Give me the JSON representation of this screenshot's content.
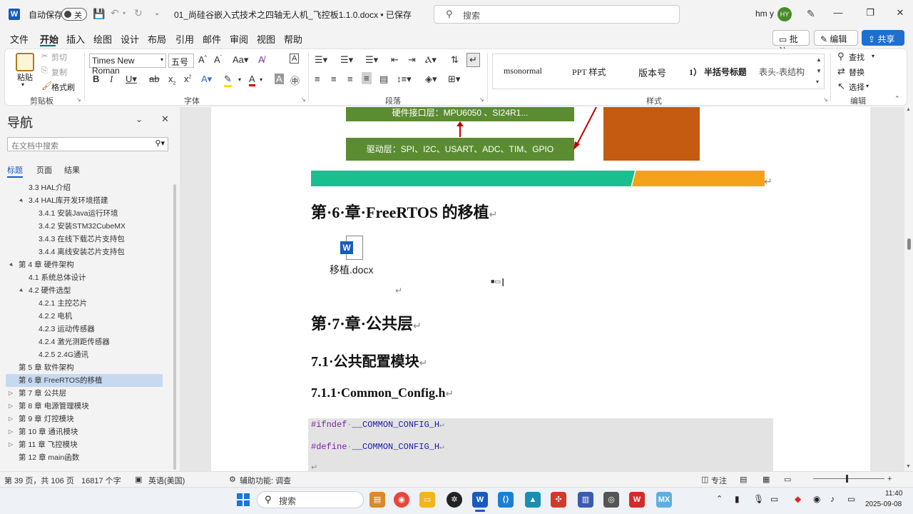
{
  "titlebar": {
    "autosave_label": "自动保存",
    "autosave_state": "关",
    "doc_title": "01_尚硅谷嵌入式技术之四轴无人机_飞控板1.1.0.docx • 已保存",
    "search_placeholder": "搜索",
    "user_name": "hm y",
    "user_initials": "HY"
  },
  "menu": {
    "tabs": [
      "文件",
      "开始",
      "插入",
      "绘图",
      "设计",
      "布局",
      "引用",
      "邮件",
      "审阅",
      "视图",
      "帮助"
    ],
    "comment_btn": "批注",
    "edit_btn": "编辑",
    "share_btn": "共享"
  },
  "ribbon": {
    "clipboard": {
      "paste": "粘贴",
      "cut": "剪切",
      "copy": "复制",
      "format_painter": "格式刷",
      "label": "剪贴板"
    },
    "font": {
      "name": "Times New Roman",
      "size": "五号",
      "label": "字体"
    },
    "paragraph": {
      "label": "段落"
    },
    "styles": {
      "items": [
        "msonormal",
        "PPT 样式",
        "版本号",
        "1） 半括号标题",
        "表头-表结构"
      ],
      "label": "样式"
    },
    "editing": {
      "find": "查找",
      "replace": "替换",
      "select": "选择",
      "label": "编辑"
    }
  },
  "nav": {
    "title": "导航",
    "search_placeholder": "在文档中搜索",
    "tabs": [
      "标题",
      "页面",
      "结果"
    ],
    "items": [
      {
        "text": "3.3 HAL介绍",
        "level": 2,
        "expand": ""
      },
      {
        "text": "3.4 HAL库开发环境搭建",
        "level": 2,
        "expand": "▲"
      },
      {
        "text": "3.4.1 安装Java运行环境",
        "level": 3,
        "expand": ""
      },
      {
        "text": "3.4.2 安装STM32CubeMX",
        "level": 3,
        "expand": ""
      },
      {
        "text": "3.4.3 在线下载芯片支持包",
        "level": 3,
        "expand": ""
      },
      {
        "text": "3.4.4 离线安装芯片支持包",
        "level": 3,
        "expand": ""
      },
      {
        "text": "第 4 章 硬件架构",
        "level": 1,
        "expand": "▲"
      },
      {
        "text": "4.1 系统总体设计",
        "level": 2,
        "expand": ""
      },
      {
        "text": "4.2 硬件选型",
        "level": 2,
        "expand": "▲"
      },
      {
        "text": "4.2.1 主控芯片",
        "level": 3,
        "expand": ""
      },
      {
        "text": "4.2.2 电机",
        "level": 3,
        "expand": ""
      },
      {
        "text": "4.2.3 运动传感器",
        "level": 3,
        "expand": ""
      },
      {
        "text": "4.2.4 激光测距传感器",
        "level": 3,
        "expand": ""
      },
      {
        "text": "4.2.5 2.4G通讯",
        "level": 3,
        "expand": ""
      },
      {
        "text": "第 5 章 软件架构",
        "level": 1,
        "expand": ""
      },
      {
        "text": "第 6 章 FreeRTOS的移植",
        "level": 1,
        "expand": "",
        "selected": true
      },
      {
        "text": "第 7 章 公共层",
        "level": 1,
        "expand": "▷"
      },
      {
        "text": "第 8 章 电源管理模块",
        "level": 1,
        "expand": "▷"
      },
      {
        "text": "第 9 章 灯控模块",
        "level": 1,
        "expand": "▷"
      },
      {
        "text": "第 10 章 通讯模块",
        "level": 1,
        "expand": "▷"
      },
      {
        "text": "第 11 章 飞控模块",
        "level": 1,
        "expand": "▷"
      },
      {
        "text": "第 12 章 main函数",
        "level": 1,
        "expand": ""
      }
    ]
  },
  "doc": {
    "diagram": {
      "hw_interface": "硬件接口层：MPU6050 、SI24R1...",
      "driver": "驱动层：SPI、I2C、USART、ADC、TIM、GPIO"
    },
    "chapter6": "第·6·章·FreeRTOS 的移植",
    "attachment": "移植.docx",
    "chapter7": "第·7·章·公共层",
    "sec71": "7.1·公共配置模块",
    "sec711": "7.1.1·Common_Config.h",
    "code_lines": [
      {
        "kw": "#ifndef",
        "sp": "·",
        "macro": "__COMMON_CONFIG_H"
      },
      {
        "kw": "#define",
        "sp": "·",
        "macro": "__COMMON_CONFIG_H"
      }
    ],
    "para_mark": "↵"
  },
  "status": {
    "page": "第 39 页，共 106 页",
    "words": "16817 个字",
    "lang": "英语(美国)",
    "accessibility": "辅助功能: 调查",
    "focus": "专注"
  },
  "taskbar": {
    "search": "搜索",
    "time": "11:40",
    "date": "2025-09-08"
  },
  "colors": {
    "accent": "#185abd",
    "green_box": "#5b8c32",
    "orange_box": "#c55a11",
    "teal_bar": "#19bf8e",
    "orange_bar": "#f5a21a"
  }
}
